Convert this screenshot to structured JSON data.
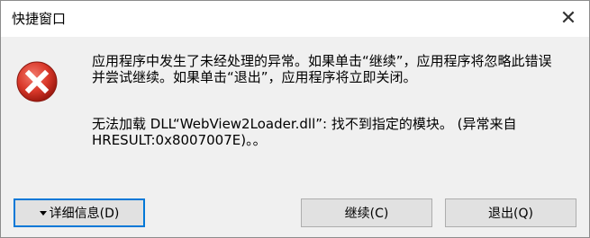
{
  "window": {
    "title": "快捷窗口",
    "close_glyph": "✕"
  },
  "dialog": {
    "icon": "error-icon",
    "message_line1": "应用程序中发生了未经处理的异常。如果单击“继续”，应用程序将忽略此错误并尝试继续。如果单击“退出”，应用程序将立即关闭。",
    "message_line2": "无法加载 DLL“WebView2Loader.dll”: 找不到指定的模块。 (异常来自 HRESULT:0x8007007E)。。"
  },
  "buttons": {
    "details_label": "详细信息(D)",
    "continue_label": "继续(C)",
    "quit_label": "退出(Q)"
  },
  "colors": {
    "error_red": "#c42b1c",
    "focus_blue": "#0078d7"
  }
}
